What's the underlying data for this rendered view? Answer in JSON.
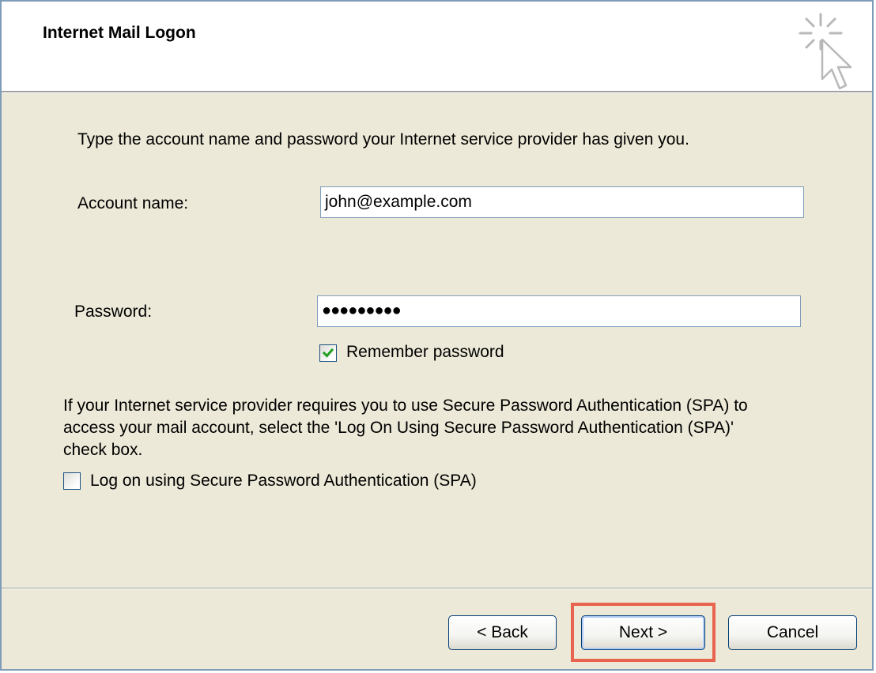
{
  "dialog": {
    "title": "Internet Mail Logon",
    "icon": "wizard-cursor-icon"
  },
  "form": {
    "instruction": "Type the account name and password your Internet service provider has given you.",
    "account_label": "Account name:",
    "account_value": "john@example.com",
    "password_label": "Password:",
    "password_masked": "●●●●●●●●●",
    "remember_label": "Remember password",
    "remember_checked": true,
    "spa_info": "If your Internet service provider requires you to use Secure Password Authentication (SPA) to access your mail account, select the 'Log On Using Secure Password Authentication (SPA)' check box.",
    "spa_label": "Log on using Secure Password Authentication (SPA)",
    "spa_checked": false
  },
  "buttons": {
    "back": "< Back",
    "next": "Next >",
    "cancel": "Cancel"
  },
  "colors": {
    "dialog_bg": "#ece9d8",
    "highlight": "#e8644e",
    "checkmark": "#21a121"
  }
}
